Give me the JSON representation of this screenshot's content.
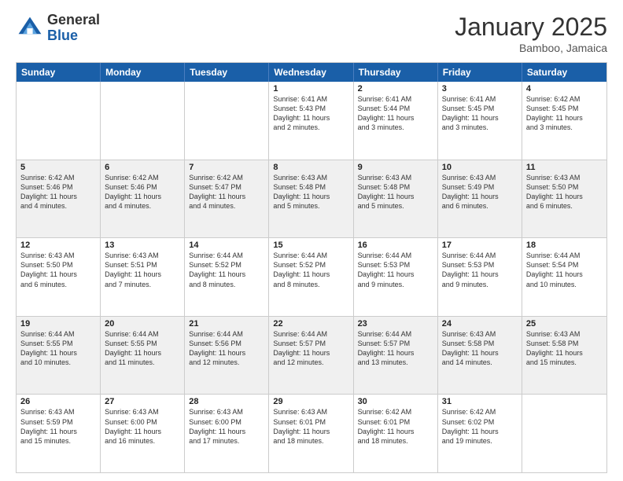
{
  "header": {
    "logo_general": "General",
    "logo_blue": "Blue",
    "month_title": "January 2025",
    "location": "Bamboo, Jamaica"
  },
  "days_of_week": [
    "Sunday",
    "Monday",
    "Tuesday",
    "Wednesday",
    "Thursday",
    "Friday",
    "Saturday"
  ],
  "rows": [
    [
      {
        "day": "",
        "lines": []
      },
      {
        "day": "",
        "lines": []
      },
      {
        "day": "",
        "lines": []
      },
      {
        "day": "1",
        "lines": [
          "Sunrise: 6:41 AM",
          "Sunset: 5:43 PM",
          "Daylight: 11 hours",
          "and 2 minutes."
        ]
      },
      {
        "day": "2",
        "lines": [
          "Sunrise: 6:41 AM",
          "Sunset: 5:44 PM",
          "Daylight: 11 hours",
          "and 3 minutes."
        ]
      },
      {
        "day": "3",
        "lines": [
          "Sunrise: 6:41 AM",
          "Sunset: 5:45 PM",
          "Daylight: 11 hours",
          "and 3 minutes."
        ]
      },
      {
        "day": "4",
        "lines": [
          "Sunrise: 6:42 AM",
          "Sunset: 5:45 PM",
          "Daylight: 11 hours",
          "and 3 minutes."
        ]
      }
    ],
    [
      {
        "day": "5",
        "lines": [
          "Sunrise: 6:42 AM",
          "Sunset: 5:46 PM",
          "Daylight: 11 hours",
          "and 4 minutes."
        ]
      },
      {
        "day": "6",
        "lines": [
          "Sunrise: 6:42 AM",
          "Sunset: 5:46 PM",
          "Daylight: 11 hours",
          "and 4 minutes."
        ]
      },
      {
        "day": "7",
        "lines": [
          "Sunrise: 6:42 AM",
          "Sunset: 5:47 PM",
          "Daylight: 11 hours",
          "and 4 minutes."
        ]
      },
      {
        "day": "8",
        "lines": [
          "Sunrise: 6:43 AM",
          "Sunset: 5:48 PM",
          "Daylight: 11 hours",
          "and 5 minutes."
        ]
      },
      {
        "day": "9",
        "lines": [
          "Sunrise: 6:43 AM",
          "Sunset: 5:48 PM",
          "Daylight: 11 hours",
          "and 5 minutes."
        ]
      },
      {
        "day": "10",
        "lines": [
          "Sunrise: 6:43 AM",
          "Sunset: 5:49 PM",
          "Daylight: 11 hours",
          "and 6 minutes."
        ]
      },
      {
        "day": "11",
        "lines": [
          "Sunrise: 6:43 AM",
          "Sunset: 5:50 PM",
          "Daylight: 11 hours",
          "and 6 minutes."
        ]
      }
    ],
    [
      {
        "day": "12",
        "lines": [
          "Sunrise: 6:43 AM",
          "Sunset: 5:50 PM",
          "Daylight: 11 hours",
          "and 6 minutes."
        ]
      },
      {
        "day": "13",
        "lines": [
          "Sunrise: 6:43 AM",
          "Sunset: 5:51 PM",
          "Daylight: 11 hours",
          "and 7 minutes."
        ]
      },
      {
        "day": "14",
        "lines": [
          "Sunrise: 6:44 AM",
          "Sunset: 5:52 PM",
          "Daylight: 11 hours",
          "and 8 minutes."
        ]
      },
      {
        "day": "15",
        "lines": [
          "Sunrise: 6:44 AM",
          "Sunset: 5:52 PM",
          "Daylight: 11 hours",
          "and 8 minutes."
        ]
      },
      {
        "day": "16",
        "lines": [
          "Sunrise: 6:44 AM",
          "Sunset: 5:53 PM",
          "Daylight: 11 hours",
          "and 9 minutes."
        ]
      },
      {
        "day": "17",
        "lines": [
          "Sunrise: 6:44 AM",
          "Sunset: 5:53 PM",
          "Daylight: 11 hours",
          "and 9 minutes."
        ]
      },
      {
        "day": "18",
        "lines": [
          "Sunrise: 6:44 AM",
          "Sunset: 5:54 PM",
          "Daylight: 11 hours",
          "and 10 minutes."
        ]
      }
    ],
    [
      {
        "day": "19",
        "lines": [
          "Sunrise: 6:44 AM",
          "Sunset: 5:55 PM",
          "Daylight: 11 hours",
          "and 10 minutes."
        ]
      },
      {
        "day": "20",
        "lines": [
          "Sunrise: 6:44 AM",
          "Sunset: 5:55 PM",
          "Daylight: 11 hours",
          "and 11 minutes."
        ]
      },
      {
        "day": "21",
        "lines": [
          "Sunrise: 6:44 AM",
          "Sunset: 5:56 PM",
          "Daylight: 11 hours",
          "and 12 minutes."
        ]
      },
      {
        "day": "22",
        "lines": [
          "Sunrise: 6:44 AM",
          "Sunset: 5:57 PM",
          "Daylight: 11 hours",
          "and 12 minutes."
        ]
      },
      {
        "day": "23",
        "lines": [
          "Sunrise: 6:44 AM",
          "Sunset: 5:57 PM",
          "Daylight: 11 hours",
          "and 13 minutes."
        ]
      },
      {
        "day": "24",
        "lines": [
          "Sunrise: 6:43 AM",
          "Sunset: 5:58 PM",
          "Daylight: 11 hours",
          "and 14 minutes."
        ]
      },
      {
        "day": "25",
        "lines": [
          "Sunrise: 6:43 AM",
          "Sunset: 5:58 PM",
          "Daylight: 11 hours",
          "and 15 minutes."
        ]
      }
    ],
    [
      {
        "day": "26",
        "lines": [
          "Sunrise: 6:43 AM",
          "Sunset: 5:59 PM",
          "Daylight: 11 hours",
          "and 15 minutes."
        ]
      },
      {
        "day": "27",
        "lines": [
          "Sunrise: 6:43 AM",
          "Sunset: 6:00 PM",
          "Daylight: 11 hours",
          "and 16 minutes."
        ]
      },
      {
        "day": "28",
        "lines": [
          "Sunrise: 6:43 AM",
          "Sunset: 6:00 PM",
          "Daylight: 11 hours",
          "and 17 minutes."
        ]
      },
      {
        "day": "29",
        "lines": [
          "Sunrise: 6:43 AM",
          "Sunset: 6:01 PM",
          "Daylight: 11 hours",
          "and 18 minutes."
        ]
      },
      {
        "day": "30",
        "lines": [
          "Sunrise: 6:42 AM",
          "Sunset: 6:01 PM",
          "Daylight: 11 hours",
          "and 18 minutes."
        ]
      },
      {
        "day": "31",
        "lines": [
          "Sunrise: 6:42 AM",
          "Sunset: 6:02 PM",
          "Daylight: 11 hours",
          "and 19 minutes."
        ]
      },
      {
        "day": "",
        "lines": []
      }
    ]
  ],
  "shaded_rows": [
    1,
    3
  ]
}
